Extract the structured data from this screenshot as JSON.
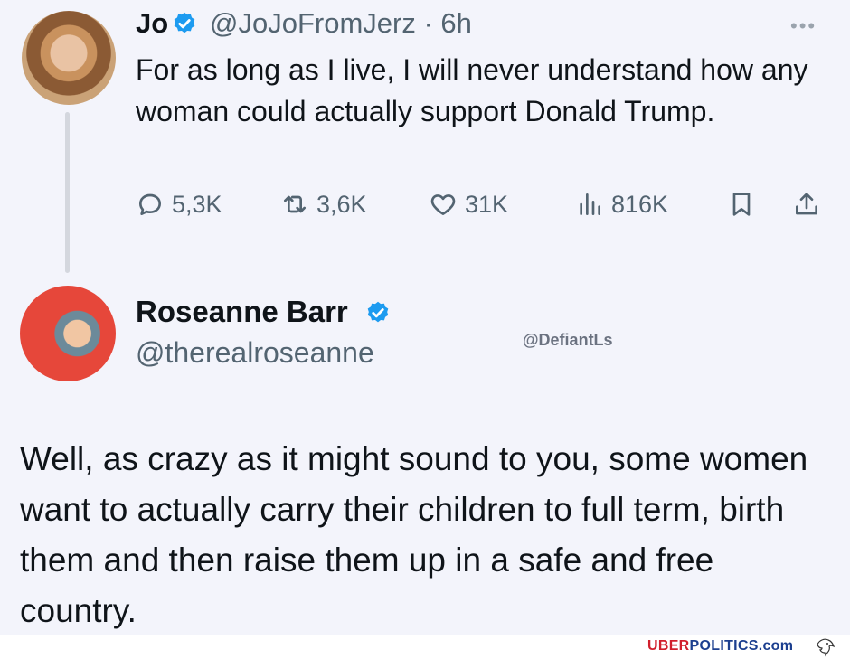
{
  "tweet1": {
    "name": "Jo",
    "handle_time": "@JoJoFromJerz · 6h",
    "more": "•••",
    "text": "For as long as I live, I will never understand how any woman could actually support Donald Trump.",
    "replies": "5,3K",
    "retweets": "3,6K",
    "likes": "31K",
    "views": "816K"
  },
  "tweet2": {
    "name": "Roseanne Barr",
    "handle": "@therealroseanne",
    "text": "Well, as crazy as it might sound to you, some women want to actually carry their children to full term, birth them and then raise them up in a safe and free country."
  },
  "watermark": "@DefiantLs",
  "footer": {
    "brand_red": "UBER",
    "brand_blue": "POLITICS",
    "brand_suffix": ".com"
  },
  "colors": {
    "verified": "#1d9bf0",
    "muted": "#536471",
    "background": "#f3f4fb"
  }
}
